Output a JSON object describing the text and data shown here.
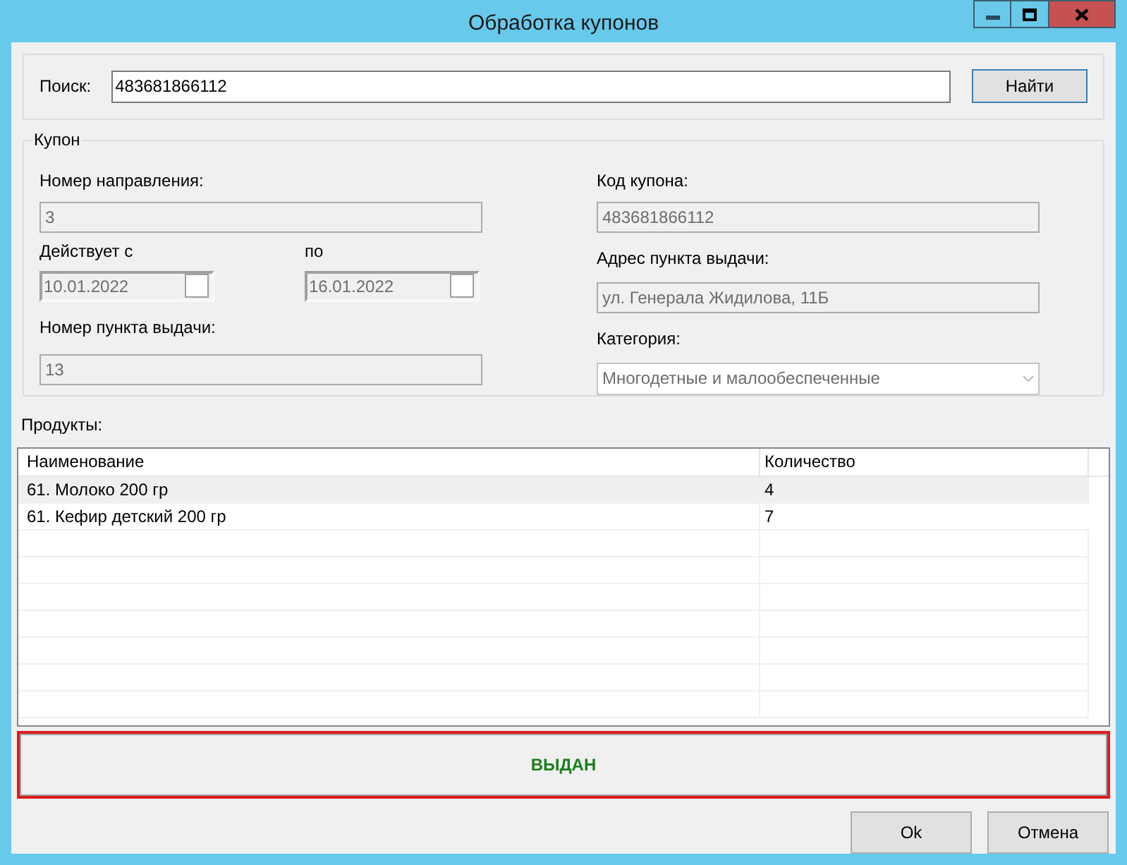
{
  "window": {
    "title": "Обработка купонов"
  },
  "search": {
    "label": "Поиск:",
    "value": "483681866112",
    "button": "Найти"
  },
  "coupon": {
    "title": "Купон",
    "direction_number": {
      "label": "Номер направления:",
      "value": "3"
    },
    "valid_from": {
      "label": "Действует с",
      "value": "10.01.2022",
      "checked": false
    },
    "valid_to": {
      "label": "по",
      "value": "16.01.2022",
      "checked": false
    },
    "point_number": {
      "label": "Номер пункта выдачи:",
      "value": "13"
    },
    "coupon_code": {
      "label": "Код купона:",
      "value": "483681866112"
    },
    "point_address": {
      "label": "Адрес пункта выдачи:",
      "value": "ул. Генерала Жидилова, 11Б"
    },
    "category": {
      "label": "Категория:",
      "value": "Многодетные и малообеспеченные"
    }
  },
  "products": {
    "label": "Продукты:",
    "columns": [
      "Наименование",
      "Количество"
    ],
    "rows": [
      {
        "name": "61. Молоко 200 гр",
        "quantity": "4",
        "selected": true
      },
      {
        "name": "61. Кефир детский 200 гр",
        "quantity": "7",
        "selected": false
      }
    ]
  },
  "status": {
    "text": "ВЫДАН",
    "kind": "issued"
  },
  "buttons": [
    "Ok",
    "Отмена"
  ]
}
